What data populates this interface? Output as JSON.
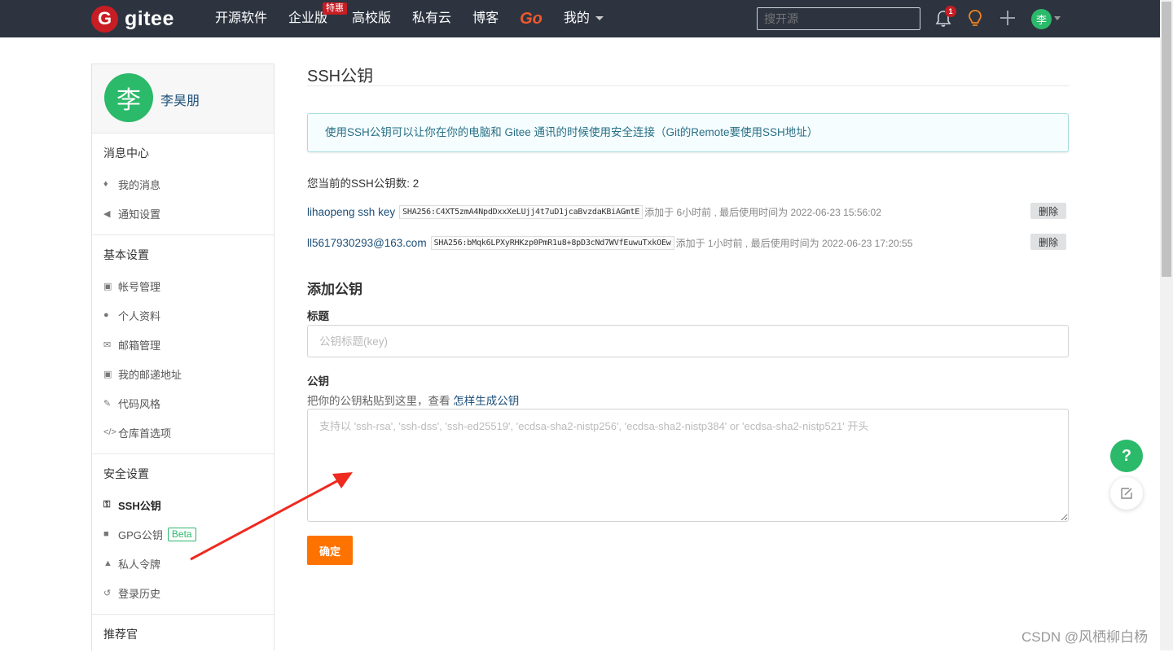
{
  "header": {
    "logo_mark": "G",
    "logo_text": "gitee",
    "nav": [
      {
        "label": "开源软件"
      },
      {
        "label": "企业版",
        "badge": "特惠"
      },
      {
        "label": "高校版"
      },
      {
        "label": "私有云"
      },
      {
        "label": "博客"
      },
      {
        "label": "Go"
      },
      {
        "label": "我的"
      }
    ],
    "search_placeholder": "搜开源",
    "notification_count": "1",
    "avatar_initial": "李"
  },
  "sidebar": {
    "user_initial": "李",
    "user_name": "李昊朋",
    "sections": [
      {
        "title": "消息中心",
        "items": [
          {
            "icon": "bell-icon",
            "label": "我的消息"
          },
          {
            "icon": "speaker-icon",
            "label": "通知设置"
          }
        ]
      },
      {
        "title": "基本设置",
        "items": [
          {
            "icon": "id-card-icon",
            "label": "帐号管理"
          },
          {
            "icon": "user-icon",
            "label": "个人资料"
          },
          {
            "icon": "mail-icon",
            "label": "邮箱管理"
          },
          {
            "icon": "address-card-icon",
            "label": "我的邮递地址"
          },
          {
            "icon": "paint-brush-icon",
            "label": "代码风格"
          },
          {
            "icon": "code-icon",
            "label": "仓库首选项"
          }
        ]
      },
      {
        "title": "安全设置",
        "items": [
          {
            "icon": "key-icon",
            "label": "SSH公钥",
            "active": true
          },
          {
            "icon": "lock-icon",
            "label": "GPG公钥",
            "badge": "Beta"
          },
          {
            "icon": "token-icon",
            "label": "私人令牌"
          },
          {
            "icon": "history-icon",
            "label": "登录历史"
          }
        ]
      },
      {
        "title": "推荐官",
        "items": []
      }
    ]
  },
  "main": {
    "title": "SSH公钥",
    "info": "使用SSH公钥可以让你在你的电脑和 Gitee 通讯的时候使用安全连接（Git的Remote要使用SSH地址）",
    "count_label": "您当前的SSH公钥数: 2",
    "keys": [
      {
        "name": "lihaopeng ssh key",
        "fingerprint": "SHA256:C4XT5zmA4NpdDxxXeLUjj4t7uD1jcaBvzdaKBiAGmtE",
        "meta": "添加于 6小时前 , 最后使用时间为 2022-06-23 15:56:02",
        "delete": "删除"
      },
      {
        "name": "ll5617930293@163.com",
        "fingerprint": "SHA256:bMqk6LPXyRHKzp0PmR1u8+8pD3cNd7WVfEuwuTxkOEw",
        "meta": "添加于 1小时前 , 最后使用时间为 2022-06-23 17:20:55",
        "delete": "删除"
      }
    ],
    "add_title": "添加公钥",
    "title_label": "标题",
    "title_placeholder": "公钥标题(key)",
    "key_label": "公钥",
    "key_hint": "把你的公钥粘贴到这里，查看",
    "key_hint_link": "怎样生成公钥",
    "key_placeholder": "支持以 'ssh-rsa', 'ssh-dss', 'ssh-ed25519', 'ecdsa-sha2-nistp256', 'ecdsa-sha2-nistp384' or 'ecdsa-sha2-nistp521' 开头",
    "submit": "确定"
  },
  "float": {
    "help": "?"
  },
  "watermark": "CSDN @风栖柳白杨",
  "colors": {
    "brand": "#c71d23",
    "nav_bg": "#2d3440",
    "accent_green": "#2bb96a",
    "submit_orange": "#fe7300",
    "annotation_arrow": "#ef2a1f"
  }
}
